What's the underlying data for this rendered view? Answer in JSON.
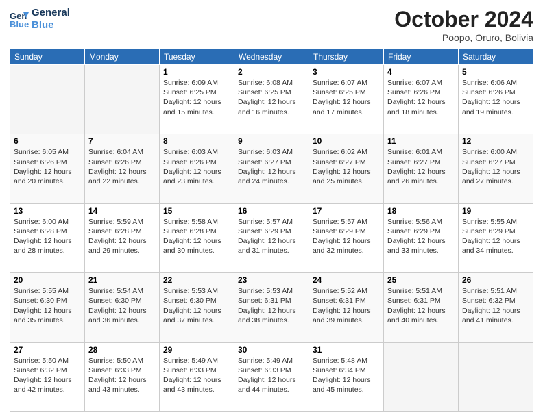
{
  "header": {
    "logo_line1": "General",
    "logo_line2": "Blue",
    "title": "October 2024",
    "location": "Poopo, Oruro, Bolivia"
  },
  "weekdays": [
    "Sunday",
    "Monday",
    "Tuesday",
    "Wednesday",
    "Thursday",
    "Friday",
    "Saturday"
  ],
  "weeks": [
    [
      {
        "day": "",
        "empty": true
      },
      {
        "day": "",
        "empty": true
      },
      {
        "day": "1",
        "sunrise": "6:09 AM",
        "sunset": "6:25 PM",
        "daylight": "12 hours and 15 minutes."
      },
      {
        "day": "2",
        "sunrise": "6:08 AM",
        "sunset": "6:25 PM",
        "daylight": "12 hours and 16 minutes."
      },
      {
        "day": "3",
        "sunrise": "6:07 AM",
        "sunset": "6:25 PM",
        "daylight": "12 hours and 17 minutes."
      },
      {
        "day": "4",
        "sunrise": "6:07 AM",
        "sunset": "6:26 PM",
        "daylight": "12 hours and 18 minutes."
      },
      {
        "day": "5",
        "sunrise": "6:06 AM",
        "sunset": "6:26 PM",
        "daylight": "12 hours and 19 minutes."
      }
    ],
    [
      {
        "day": "6",
        "sunrise": "6:05 AM",
        "sunset": "6:26 PM",
        "daylight": "12 hours and 20 minutes."
      },
      {
        "day": "7",
        "sunrise": "6:04 AM",
        "sunset": "6:26 PM",
        "daylight": "12 hours and 22 minutes."
      },
      {
        "day": "8",
        "sunrise": "6:03 AM",
        "sunset": "6:26 PM",
        "daylight": "12 hours and 23 minutes."
      },
      {
        "day": "9",
        "sunrise": "6:03 AM",
        "sunset": "6:27 PM",
        "daylight": "12 hours and 24 minutes."
      },
      {
        "day": "10",
        "sunrise": "6:02 AM",
        "sunset": "6:27 PM",
        "daylight": "12 hours and 25 minutes."
      },
      {
        "day": "11",
        "sunrise": "6:01 AM",
        "sunset": "6:27 PM",
        "daylight": "12 hours and 26 minutes."
      },
      {
        "day": "12",
        "sunrise": "6:00 AM",
        "sunset": "6:27 PM",
        "daylight": "12 hours and 27 minutes."
      }
    ],
    [
      {
        "day": "13",
        "sunrise": "6:00 AM",
        "sunset": "6:28 PM",
        "daylight": "12 hours and 28 minutes."
      },
      {
        "day": "14",
        "sunrise": "5:59 AM",
        "sunset": "6:28 PM",
        "daylight": "12 hours and 29 minutes."
      },
      {
        "day": "15",
        "sunrise": "5:58 AM",
        "sunset": "6:28 PM",
        "daylight": "12 hours and 30 minutes."
      },
      {
        "day": "16",
        "sunrise": "5:57 AM",
        "sunset": "6:29 PM",
        "daylight": "12 hours and 31 minutes."
      },
      {
        "day": "17",
        "sunrise": "5:57 AM",
        "sunset": "6:29 PM",
        "daylight": "12 hours and 32 minutes."
      },
      {
        "day": "18",
        "sunrise": "5:56 AM",
        "sunset": "6:29 PM",
        "daylight": "12 hours and 33 minutes."
      },
      {
        "day": "19",
        "sunrise": "5:55 AM",
        "sunset": "6:29 PM",
        "daylight": "12 hours and 34 minutes."
      }
    ],
    [
      {
        "day": "20",
        "sunrise": "5:55 AM",
        "sunset": "6:30 PM",
        "daylight": "12 hours and 35 minutes."
      },
      {
        "day": "21",
        "sunrise": "5:54 AM",
        "sunset": "6:30 PM",
        "daylight": "12 hours and 36 minutes."
      },
      {
        "day": "22",
        "sunrise": "5:53 AM",
        "sunset": "6:30 PM",
        "daylight": "12 hours and 37 minutes."
      },
      {
        "day": "23",
        "sunrise": "5:53 AM",
        "sunset": "6:31 PM",
        "daylight": "12 hours and 38 minutes."
      },
      {
        "day": "24",
        "sunrise": "5:52 AM",
        "sunset": "6:31 PM",
        "daylight": "12 hours and 39 minutes."
      },
      {
        "day": "25",
        "sunrise": "5:51 AM",
        "sunset": "6:31 PM",
        "daylight": "12 hours and 40 minutes."
      },
      {
        "day": "26",
        "sunrise": "5:51 AM",
        "sunset": "6:32 PM",
        "daylight": "12 hours and 41 minutes."
      }
    ],
    [
      {
        "day": "27",
        "sunrise": "5:50 AM",
        "sunset": "6:32 PM",
        "daylight": "12 hours and 42 minutes."
      },
      {
        "day": "28",
        "sunrise": "5:50 AM",
        "sunset": "6:33 PM",
        "daylight": "12 hours and 43 minutes."
      },
      {
        "day": "29",
        "sunrise": "5:49 AM",
        "sunset": "6:33 PM",
        "daylight": "12 hours and 43 minutes."
      },
      {
        "day": "30",
        "sunrise": "5:49 AM",
        "sunset": "6:33 PM",
        "daylight": "12 hours and 44 minutes."
      },
      {
        "day": "31",
        "sunrise": "5:48 AM",
        "sunset": "6:34 PM",
        "daylight": "12 hours and 45 minutes."
      },
      {
        "day": "",
        "empty": true
      },
      {
        "day": "",
        "empty": true
      }
    ]
  ],
  "labels": {
    "sunrise_prefix": "Sunrise: ",
    "sunset_prefix": "Sunset: ",
    "daylight_prefix": "Daylight: "
  }
}
